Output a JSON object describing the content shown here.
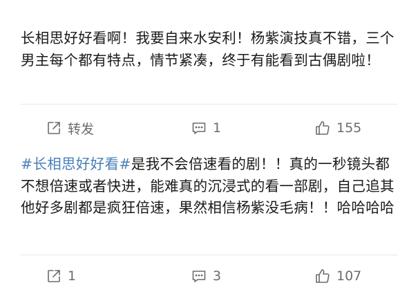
{
  "posts": [
    {
      "text": "长相思好好看啊！我要自来水安利！杨紫演技真不错，三个男主每个都有特点，情节紧凑，终于有能看到古偶剧啦！",
      "actions": {
        "repost": "转发",
        "comment": "1",
        "like": "155"
      }
    },
    {
      "hashtag": "#长相思好好看#",
      "text": "是我不会倍速看的剧！！真的一秒镜头都不想倍速或者快进，能难真的沉浸式的看一部剧，自己追其他好多剧都是疯狂倍速，果然相信杨紫没毛病！！哈哈哈哈",
      "actions": {
        "repost": "1",
        "comment": "3",
        "like": "107"
      }
    }
  ],
  "icons": {
    "repost": "share-icon",
    "comment": "comment-icon",
    "like": "thumbs-up-icon"
  },
  "colors": {
    "text": "#1a1a1a",
    "hashtag": "#4a7fb8",
    "action": "#6b6b6b",
    "divider": "#e6e6e6"
  }
}
